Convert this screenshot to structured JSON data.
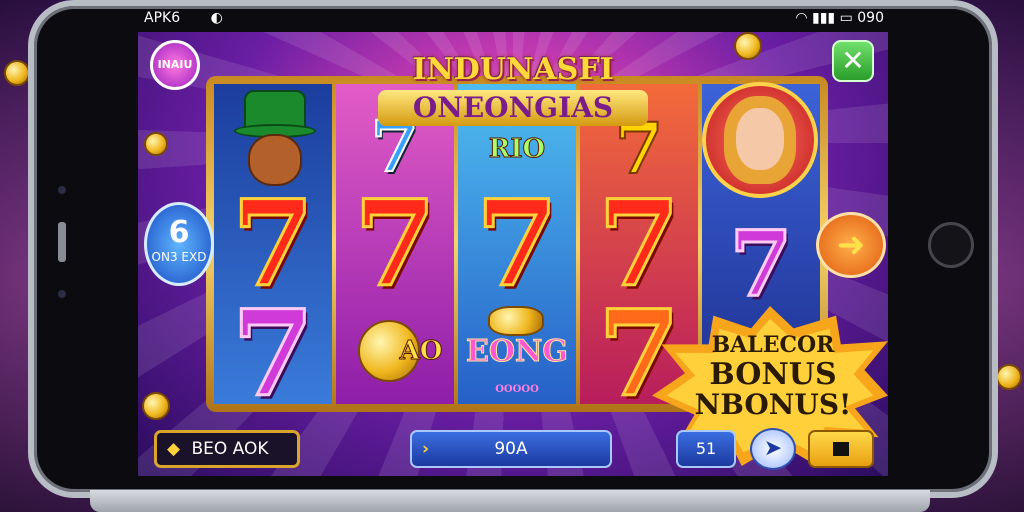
{
  "status_bar": {
    "left_text": "APK6",
    "left_icon": "android-icon",
    "right_icons": "wifi-icon signal-icon battery-icon",
    "right_text": "090"
  },
  "game": {
    "title_line1": "INDUNASFI",
    "title_line2": "ONEONGIAS",
    "top_left_badge": "INAIU",
    "left_badge_number": "6",
    "left_badge_sub": "ON3 EXD",
    "reel_symbols": {
      "reel2_coin_label": "AO",
      "reel3_top_label": "RIO",
      "reel3_bonus_label": "EONG",
      "reel3_strip_label": "OOOOO"
    },
    "bonus_burst": {
      "line1": "BALECOR",
      "line2": "BONUS",
      "line3": "NBONUS!"
    }
  },
  "bottom_bar": {
    "balance_label": "BEO AOK",
    "bet_value": "90A",
    "small_value": "51"
  },
  "colors": {
    "accent_gold": "#ffd23a",
    "primary_blue": "#1c3aa0",
    "seven_red": "#ff2a1a",
    "close_green": "#2b9d2a"
  }
}
